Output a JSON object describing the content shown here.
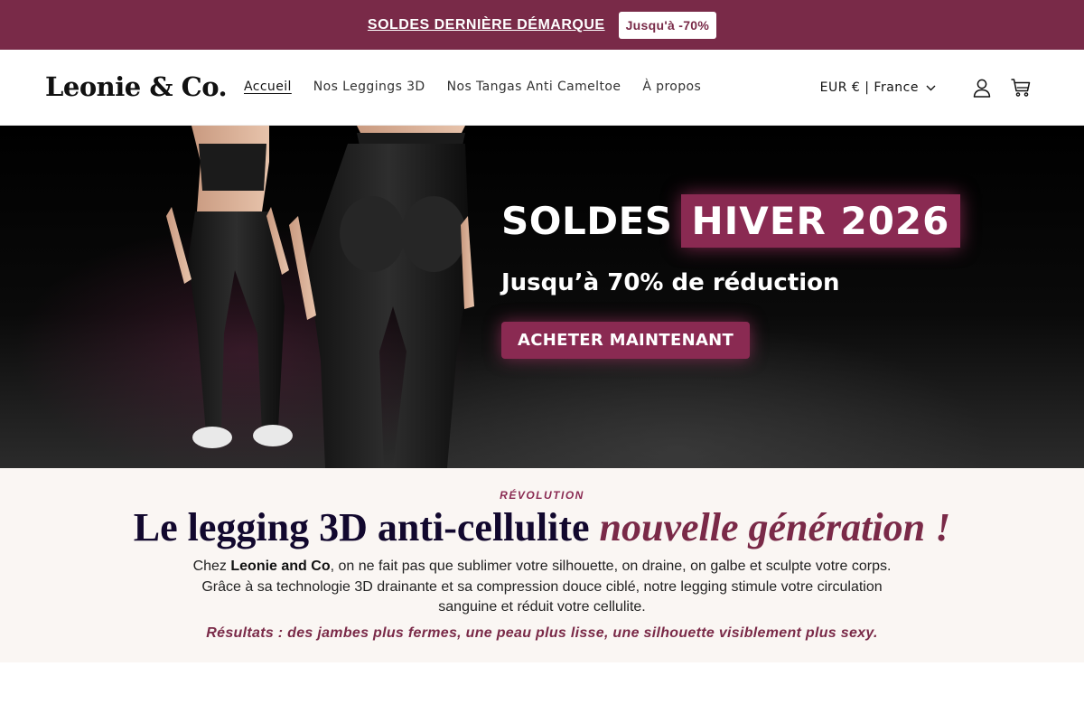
{
  "announcement": {
    "link_label": "SOLDES DERNIÈRE DÉMARQUE",
    "badge": "Jusqu'à -70%"
  },
  "header": {
    "logo": "Leonie & Co.",
    "nav": [
      {
        "label": "Accueil",
        "active": true
      },
      {
        "label": "Nos Leggings 3D",
        "active": false
      },
      {
        "label": "Nos Tangas Anti Cameltoe",
        "active": false
      },
      {
        "label": "À propos",
        "active": false
      }
    ],
    "locale": "EUR € | France",
    "icons": [
      "account-icon",
      "cart-icon"
    ]
  },
  "hero": {
    "title_white": "SOLDES",
    "title_highlight": "HIVER 2026",
    "subtitle": "Jusqu’à 70% de réduction",
    "cta": "ACHETER MAINTENANT"
  },
  "intro": {
    "eyebrow": "RÉVOLUTION",
    "title_main": "Le legging 3D anti-cellulite",
    "title_accent": "nouvelle génération !",
    "body_prefix": "Chez ",
    "body_brand": "Leonie and Co",
    "body_rest": ", on ne fait pas que sublimer votre silhouette, on draine, on galbe et sculpte votre corps. Grâce à sa technologie 3D drainante et sa compression douce ciblé, notre legging stimule votre circulation sanguine et réduit votre cellulite.",
    "results": "Résultats : des jambes plus fermes, une peau plus lisse, une silhouette visiblement plus sexy."
  },
  "colors": {
    "brand": "#792a48",
    "accent": "#8a2a52",
    "heading": "#12082e",
    "section_bg": "#faf6f3"
  }
}
